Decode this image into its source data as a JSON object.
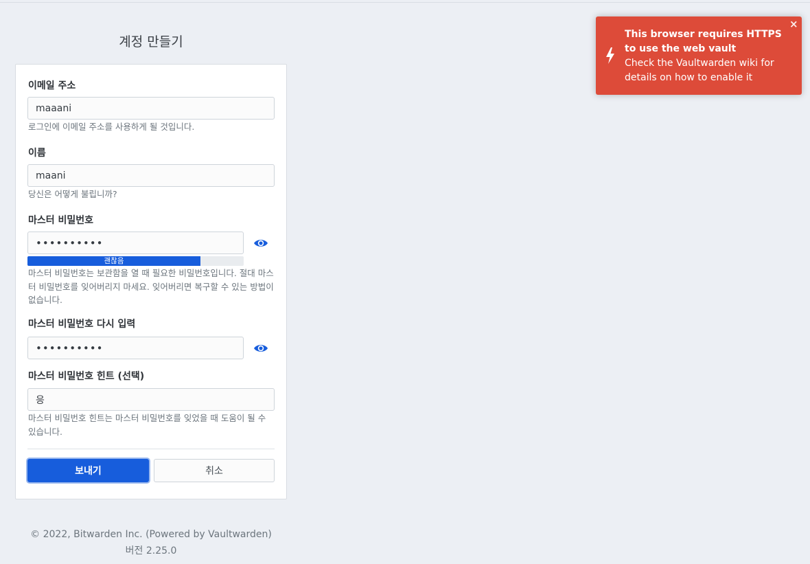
{
  "page": {
    "title": "계정 만들기"
  },
  "form": {
    "email": {
      "label": "이메일 주소",
      "value": "maaani",
      "help": "로그인에 이메일 주소를 사용하게 될 것입니다."
    },
    "name": {
      "label": "이름",
      "value": "maani",
      "help": "당신은 어떻게 불립니까?"
    },
    "master_password": {
      "label": "마스터 비밀번호",
      "value": "••••••••••",
      "strength_label": "괜찮음",
      "strength_percent": 80,
      "help": "마스터 비밀번호는 보관함을 열 때 필요한 비밀번호입니다. 절대 마스터 비밀번호를 잊어버리지 마세요. 잊어버리면 복구할 수 있는 방법이 없습니다."
    },
    "master_password_retype": {
      "label": "마스터 비밀번호 다시 입력",
      "value": "••••••••••"
    },
    "hint": {
      "label": "마스터 비밀번호 힌트 (선택)",
      "value": "응",
      "help": "마스터 비밀번호 힌트는 마스터 비밀번호를 잊었을 때 도움이 될 수 있습니다."
    },
    "submit_label": "보내기",
    "cancel_label": "취소"
  },
  "footer": {
    "copyright": "© 2022, Bitwarden Inc. (Powered by Vaultwarden)",
    "version": "버전 2.25.0"
  },
  "toast": {
    "title": "This browser requires HTTPS to use the web vault",
    "message": "Check the Vaultwarden wiki for details on how to enable it",
    "close_label": "×",
    "icon": "bolt-icon",
    "color": "#dd4b39"
  },
  "colors": {
    "primary": "#175ddc",
    "background": "#eceff4"
  }
}
